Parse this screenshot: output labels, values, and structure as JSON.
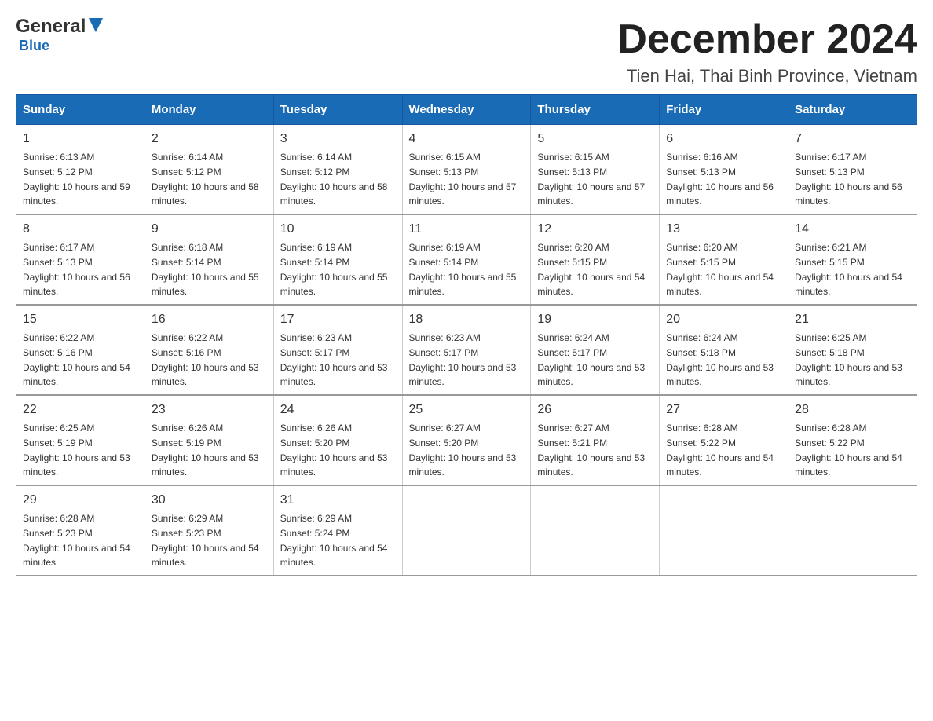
{
  "header": {
    "logo_general": "General",
    "logo_blue": "Blue",
    "month_title": "December 2024",
    "location": "Tien Hai, Thai Binh Province, Vietnam"
  },
  "weekdays": [
    "Sunday",
    "Monday",
    "Tuesday",
    "Wednesday",
    "Thursday",
    "Friday",
    "Saturday"
  ],
  "weeks": [
    [
      {
        "day": "1",
        "sunrise": "6:13 AM",
        "sunset": "5:12 PM",
        "daylight": "10 hours and 59 minutes."
      },
      {
        "day": "2",
        "sunrise": "6:14 AM",
        "sunset": "5:12 PM",
        "daylight": "10 hours and 58 minutes."
      },
      {
        "day": "3",
        "sunrise": "6:14 AM",
        "sunset": "5:12 PM",
        "daylight": "10 hours and 58 minutes."
      },
      {
        "day": "4",
        "sunrise": "6:15 AM",
        "sunset": "5:13 PM",
        "daylight": "10 hours and 57 minutes."
      },
      {
        "day": "5",
        "sunrise": "6:15 AM",
        "sunset": "5:13 PM",
        "daylight": "10 hours and 57 minutes."
      },
      {
        "day": "6",
        "sunrise": "6:16 AM",
        "sunset": "5:13 PM",
        "daylight": "10 hours and 56 minutes."
      },
      {
        "day": "7",
        "sunrise": "6:17 AM",
        "sunset": "5:13 PM",
        "daylight": "10 hours and 56 minutes."
      }
    ],
    [
      {
        "day": "8",
        "sunrise": "6:17 AM",
        "sunset": "5:13 PM",
        "daylight": "10 hours and 56 minutes."
      },
      {
        "day": "9",
        "sunrise": "6:18 AM",
        "sunset": "5:14 PM",
        "daylight": "10 hours and 55 minutes."
      },
      {
        "day": "10",
        "sunrise": "6:19 AM",
        "sunset": "5:14 PM",
        "daylight": "10 hours and 55 minutes."
      },
      {
        "day": "11",
        "sunrise": "6:19 AM",
        "sunset": "5:14 PM",
        "daylight": "10 hours and 55 minutes."
      },
      {
        "day": "12",
        "sunrise": "6:20 AM",
        "sunset": "5:15 PM",
        "daylight": "10 hours and 54 minutes."
      },
      {
        "day": "13",
        "sunrise": "6:20 AM",
        "sunset": "5:15 PM",
        "daylight": "10 hours and 54 minutes."
      },
      {
        "day": "14",
        "sunrise": "6:21 AM",
        "sunset": "5:15 PM",
        "daylight": "10 hours and 54 minutes."
      }
    ],
    [
      {
        "day": "15",
        "sunrise": "6:22 AM",
        "sunset": "5:16 PM",
        "daylight": "10 hours and 54 minutes."
      },
      {
        "day": "16",
        "sunrise": "6:22 AM",
        "sunset": "5:16 PM",
        "daylight": "10 hours and 53 minutes."
      },
      {
        "day": "17",
        "sunrise": "6:23 AM",
        "sunset": "5:17 PM",
        "daylight": "10 hours and 53 minutes."
      },
      {
        "day": "18",
        "sunrise": "6:23 AM",
        "sunset": "5:17 PM",
        "daylight": "10 hours and 53 minutes."
      },
      {
        "day": "19",
        "sunrise": "6:24 AM",
        "sunset": "5:17 PM",
        "daylight": "10 hours and 53 minutes."
      },
      {
        "day": "20",
        "sunrise": "6:24 AM",
        "sunset": "5:18 PM",
        "daylight": "10 hours and 53 minutes."
      },
      {
        "day": "21",
        "sunrise": "6:25 AM",
        "sunset": "5:18 PM",
        "daylight": "10 hours and 53 minutes."
      }
    ],
    [
      {
        "day": "22",
        "sunrise": "6:25 AM",
        "sunset": "5:19 PM",
        "daylight": "10 hours and 53 minutes."
      },
      {
        "day": "23",
        "sunrise": "6:26 AM",
        "sunset": "5:19 PM",
        "daylight": "10 hours and 53 minutes."
      },
      {
        "day": "24",
        "sunrise": "6:26 AM",
        "sunset": "5:20 PM",
        "daylight": "10 hours and 53 minutes."
      },
      {
        "day": "25",
        "sunrise": "6:27 AM",
        "sunset": "5:20 PM",
        "daylight": "10 hours and 53 minutes."
      },
      {
        "day": "26",
        "sunrise": "6:27 AM",
        "sunset": "5:21 PM",
        "daylight": "10 hours and 53 minutes."
      },
      {
        "day": "27",
        "sunrise": "6:28 AM",
        "sunset": "5:22 PM",
        "daylight": "10 hours and 54 minutes."
      },
      {
        "day": "28",
        "sunrise": "6:28 AM",
        "sunset": "5:22 PM",
        "daylight": "10 hours and 54 minutes."
      }
    ],
    [
      {
        "day": "29",
        "sunrise": "6:28 AM",
        "sunset": "5:23 PM",
        "daylight": "10 hours and 54 minutes."
      },
      {
        "day": "30",
        "sunrise": "6:29 AM",
        "sunset": "5:23 PM",
        "daylight": "10 hours and 54 minutes."
      },
      {
        "day": "31",
        "sunrise": "6:29 AM",
        "sunset": "5:24 PM",
        "daylight": "10 hours and 54 minutes."
      },
      null,
      null,
      null,
      null
    ]
  ]
}
